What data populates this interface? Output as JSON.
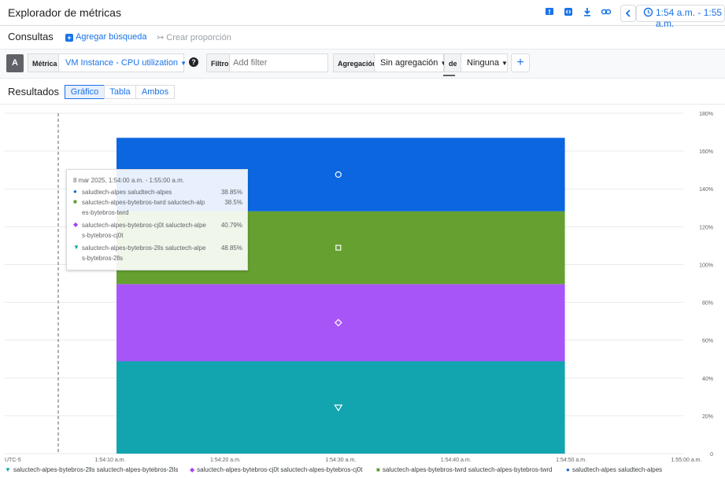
{
  "app": {
    "title": "Explorador de métricas",
    "time_range": "1:54 a.m. - 1:55 a.m."
  },
  "toolbar_icons": [
    "feedback-icon",
    "code-icon",
    "download-icon",
    "link-icon",
    "chevron-left-icon",
    "clock-icon"
  ],
  "queries": {
    "title": "Consultas",
    "add_label": "Agregar búsqueda",
    "ratio_label": "Crear proporción"
  },
  "query": {
    "letter": "A",
    "metric_label": "Métrica",
    "metric_value": "VM Instance - CPU utilization",
    "filter_label": "Filtro",
    "filter_placeholder": "Add filter",
    "aggregation_label": "Agregación",
    "aggregation_value": "Sin agregación",
    "of_label": "de",
    "group_value": "Ninguna"
  },
  "results": {
    "title": "Resultados",
    "tabs": [
      "Gráfico",
      "Tabla",
      "Ambos"
    ],
    "active_tab": 0
  },
  "tooltip": {
    "title": "8 mar 2025, 1:54:00 a.m. - 1:55:00 a.m.",
    "rows": [
      {
        "marker": "●",
        "color": "#1967d2",
        "line1": "saludtech-alpes saludtech-alpes",
        "line2": "",
        "value": "38.85%"
      },
      {
        "marker": "■",
        "color": "#5d9a2f",
        "line1": "saluctech-alpes-bytebros-twrd saluctech-alp",
        "line2": "es-bytebros-twrd",
        "value": "38.5%"
      },
      {
        "marker": "◆",
        "color": "#a142f4",
        "line1": "saluctech-alpes-bytebros-cj0t saluctech-alpe",
        "line2": "s-bytebros-cj0t",
        "value": "40.79%"
      },
      {
        "marker": "▼",
        "color": "#12a4af",
        "line1": "saluctech-alpes-bytebros-2lls saluctech-alpe",
        "line2": "s-bytebros-2lls",
        "value": "48.85%"
      }
    ]
  },
  "legend": [
    {
      "marker": "▼",
      "color": "#12a4af",
      "label": "saluctech-alpes-bytebros-2lls saluctech-alpes-bytebros-2lls"
    },
    {
      "marker": "◆",
      "color": "#a142f4",
      "label": "saluctech-alpes-bytebros-cj0t saluctech-alpes-bytebros-cj0t"
    },
    {
      "marker": "■",
      "color": "#5d9a2f",
      "label": "saluctech-alpes-bytebros-twrd saluctech-alpes-bytebros-twrd"
    },
    {
      "marker": "●",
      "color": "#1967d2",
      "label": "saludtech-alpes saludtech-alpes"
    }
  ],
  "chart_data": {
    "type": "area",
    "stacked": true,
    "timezone_label": "UTC-5",
    "x_ticks": [
      "1:54:10 a.m.",
      "1:54:20 a.m.",
      "1:54:30 a.m.",
      "1:54:40 a.m.",
      "1:54:50 a.m.",
      "1:55:00 a.m."
    ],
    "x_range_seconds": [
      0,
      55
    ],
    "bar_x_range_seconds": [
      10,
      50
    ],
    "hover_x_seconds": 10,
    "marker_x_seconds": 30,
    "y_ticks": [
      "0",
      "20%",
      "40%",
      "60%",
      "80%",
      "100%",
      "120%",
      "140%",
      "160%",
      "180%"
    ],
    "ylim": [
      0,
      180
    ],
    "grid": true,
    "series": [
      {
        "name": "saluctech-alpes-bytebros-2lls saluctech-alpes-bytebros-2lls",
        "value": 48.85,
        "color": "#12a4af",
        "marker": "triangle"
      },
      {
        "name": "saluctech-alpes-bytebros-cj0t saluctech-alpes-bytebros-cj0t",
        "value": 40.79,
        "color": "#a855f7",
        "marker": "diamond"
      },
      {
        "name": "saluctech-alpes-bytebros-twrd saluctech-alpes-bytebros-twrd",
        "value": 38.5,
        "color": "#65a030",
        "marker": "square"
      },
      {
        "name": "saludtech-alpes saludtech-alpes",
        "value": 38.85,
        "color": "#0b66e0",
        "marker": "circle"
      }
    ]
  }
}
